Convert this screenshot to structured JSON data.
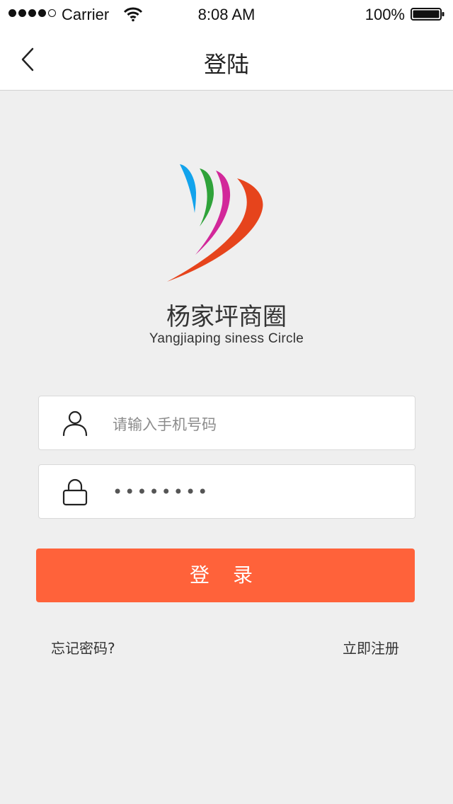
{
  "status_bar": {
    "carrier": "Carrier",
    "time": "8:08 AM",
    "battery": "100%",
    "signal_bars_filled": 4,
    "signal_bars_total": 5,
    "battery_level": 1.0
  },
  "nav": {
    "title": "登陆",
    "back_icon": "chevron-left-icon"
  },
  "brand": {
    "name": "杨家坪商圈",
    "subtitle": "Yangjiaping siness Circle",
    "logo_colors": [
      "#12a3ec",
      "#2fa33a",
      "#d2289a",
      "#e6441c"
    ]
  },
  "form": {
    "phone": {
      "placeholder": "请输入手机号码",
      "icon": "user-icon"
    },
    "password": {
      "value": "••••••••",
      "icon": "lock-icon"
    },
    "login_label": "登 录",
    "forgot_label": "忘记密码?",
    "register_label": "立即注册"
  },
  "colors": {
    "accent": "#ff623a",
    "background": "#efefef"
  }
}
